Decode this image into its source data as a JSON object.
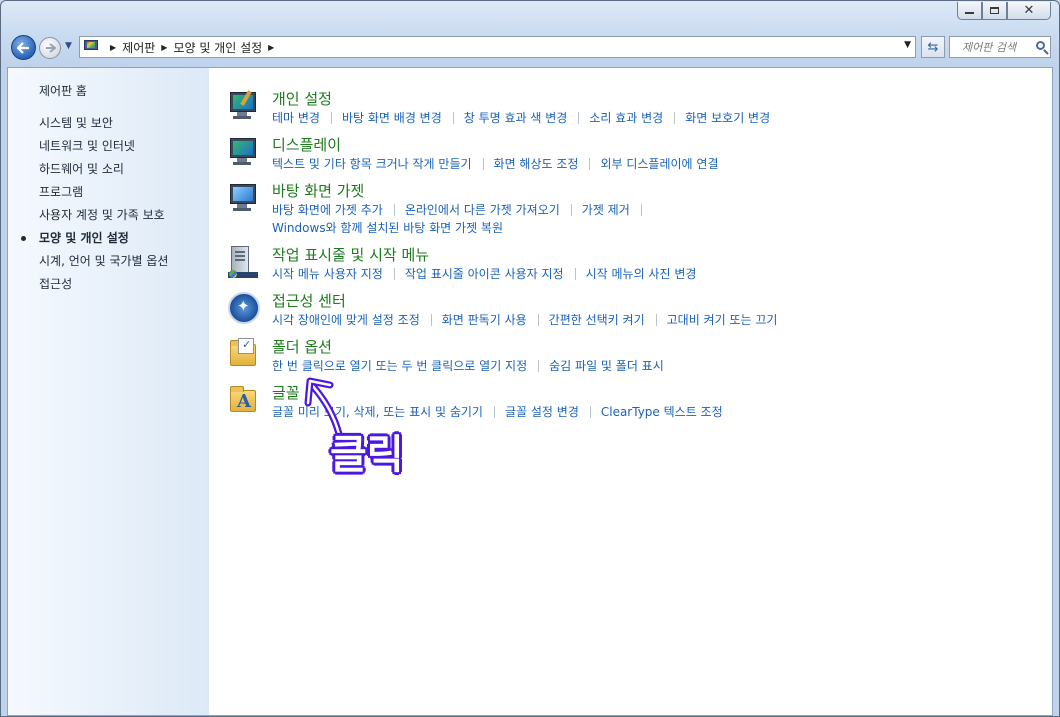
{
  "navbar": {
    "breadcrumbs": [
      "제어판",
      "모양 및 개인 설정"
    ],
    "search_placeholder": "제어판 검색"
  },
  "sidebar": {
    "home": "제어판 홈",
    "items": [
      {
        "label": "시스템 및 보안",
        "active": false
      },
      {
        "label": "네트워크 및 인터넷",
        "active": false
      },
      {
        "label": "하드웨어 및 소리",
        "active": false
      },
      {
        "label": "프로그램",
        "active": false
      },
      {
        "label": "사용자 계정 및 가족 보호",
        "active": false
      },
      {
        "label": "모양 및 개인 설정",
        "active": true
      },
      {
        "label": "시계, 언어 및 국가별 옵션",
        "active": false
      },
      {
        "label": "접근성",
        "active": false
      }
    ]
  },
  "categories": [
    {
      "title": "개인 설정",
      "icon": "personalization-icon",
      "links": [
        "테마 변경",
        "바탕 화면 배경 변경",
        "창 투명 효과 색 변경",
        "소리 효과 변경",
        "화면 보호기 변경"
      ]
    },
    {
      "title": "디스플레이",
      "icon": "display-icon",
      "links": [
        "텍스트 및 기타 항목 크거나 작게 만들기",
        "화면 해상도 조정",
        "외부 디스플레이에 연결"
      ]
    },
    {
      "title": "바탕 화면 가젯",
      "icon": "gadgets-icon",
      "links": [
        "바탕 화면에 가젯 추가",
        "온라인에서 다른 가젯 가져오기",
        "가젯 제거",
        "Windows와 함께 설치된 바탕 화면 가젯 복원"
      ]
    },
    {
      "title": "작업 표시줄 및 시작 메뉴",
      "icon": "taskbar-icon",
      "links": [
        "시작 메뉴 사용자 지정",
        "작업 표시줄 아이콘 사용자 지정",
        "시작 메뉴의 사진 변경"
      ]
    },
    {
      "title": "접근성 센터",
      "icon": "ease-of-access-icon",
      "links": [
        "시각 장애인에 맞게 설정 조정",
        "화면 판독기 사용",
        "간편한 선택키 켜기",
        "고대비 켜기 또는 끄기"
      ]
    },
    {
      "title": "폴더 옵션",
      "icon": "folder-options-icon",
      "links": [
        "한 번 클릭으로 열기 또는 두 번 클릭으로 열기 지정",
        "숨김 파일 및 폴더 표시"
      ]
    },
    {
      "title": "글꼴",
      "icon": "fonts-icon",
      "links": [
        "글꼴 미리 보기, 삭제, 또는 표시 및 숨기기",
        "글꼴 설정 변경",
        "ClearType 텍스트 조정"
      ]
    }
  ],
  "annotation": {
    "text": "클릭",
    "color": "#4b18e0"
  }
}
